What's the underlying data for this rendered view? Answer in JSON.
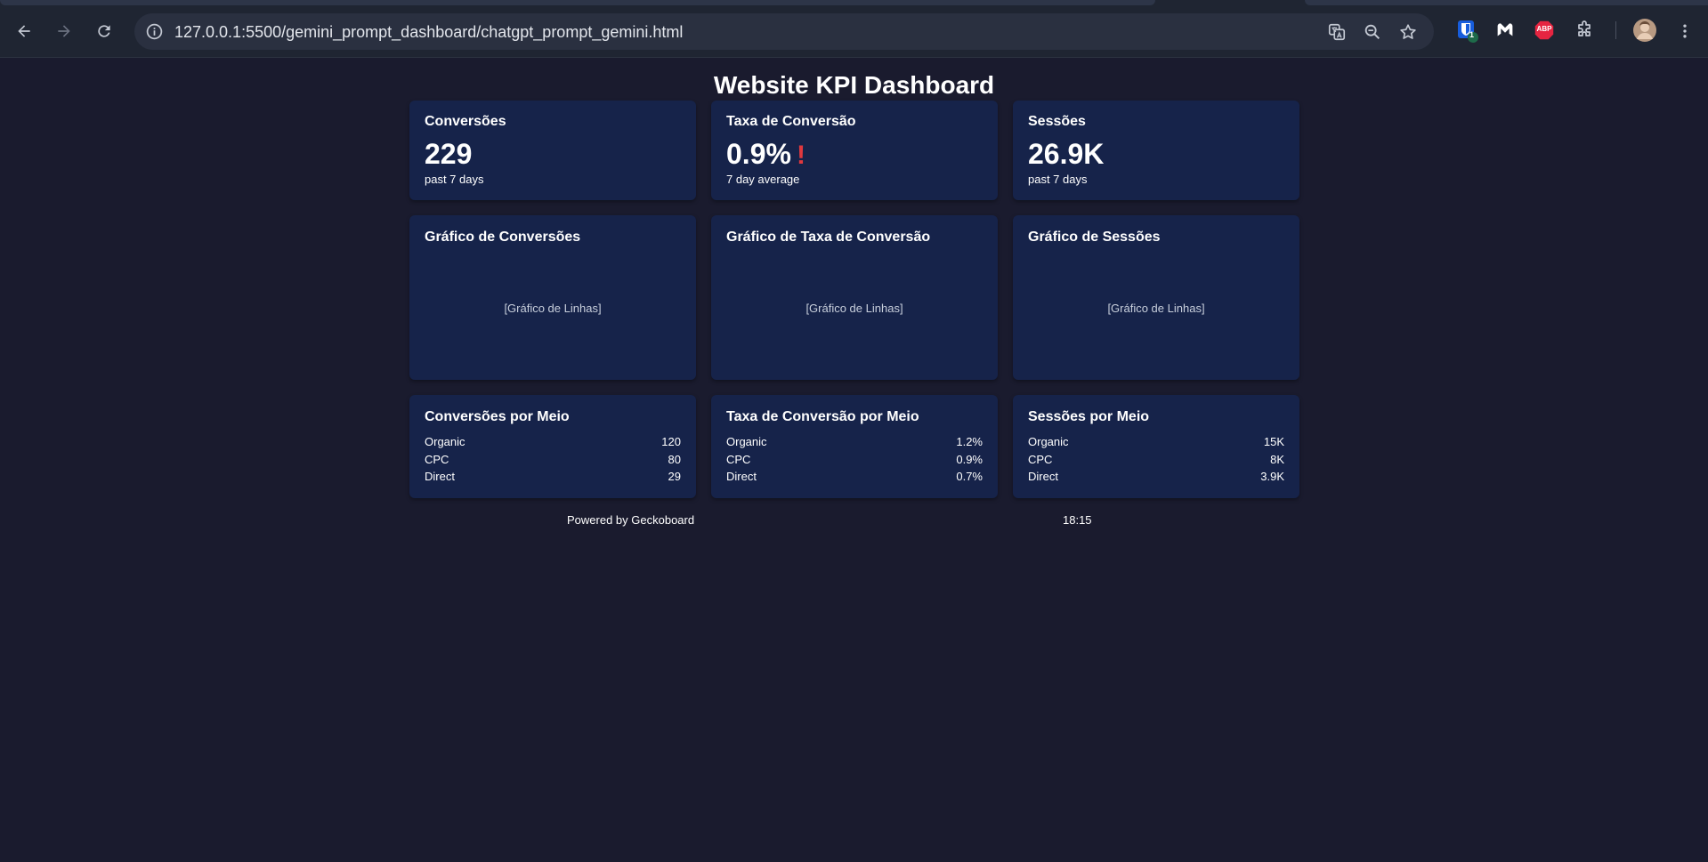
{
  "browser": {
    "url": "127.0.0.1:5500/gemini_prompt_dashboard/chatgpt_prompt_gemini.html",
    "extension_badge": "1",
    "abp_label": "ABP"
  },
  "dashboard": {
    "title": "Website KPI Dashboard",
    "kpis": [
      {
        "title": "Conversões",
        "value": "229",
        "sub": "past 7 days",
        "alert": ""
      },
      {
        "title": "Taxa de Conversão",
        "value": "0.9%",
        "sub": "7 day average",
        "alert": "!"
      },
      {
        "title": "Sessões",
        "value": "26.9K",
        "sub": "past 7 days",
        "alert": ""
      }
    ],
    "charts": [
      {
        "title": "Gráfico de Conversões",
        "placeholder": "[Gráfico de Linhas]"
      },
      {
        "title": "Gráfico de Taxa de Conversão",
        "placeholder": "[Gráfico de Linhas]"
      },
      {
        "title": "Gráfico de Sessões",
        "placeholder": "[Gráfico de Linhas]"
      }
    ],
    "breakdowns": [
      {
        "title": "Conversões por Meio",
        "rows": [
          {
            "label": "Organic",
            "value": "120"
          },
          {
            "label": "CPC",
            "value": "80"
          },
          {
            "label": "Direct",
            "value": "29"
          }
        ]
      },
      {
        "title": "Taxa de Conversão por Meio",
        "rows": [
          {
            "label": "Organic",
            "value": "1.2%"
          },
          {
            "label": "CPC",
            "value": "0.9%"
          },
          {
            "label": "Direct",
            "value": "0.7%"
          }
        ]
      },
      {
        "title": "Sessões por Meio",
        "rows": [
          {
            "label": "Organic",
            "value": "15K"
          },
          {
            "label": "CPC",
            "value": "8K"
          },
          {
            "label": "Direct",
            "value": "3.9K"
          }
        ]
      }
    ],
    "footer": {
      "powered_by": "Powered by Geckoboard",
      "time": "18:15"
    }
  },
  "colors": {
    "page_bg": "#1a1b2e",
    "card_bg": "#16234a",
    "alert": "#e0383e"
  }
}
